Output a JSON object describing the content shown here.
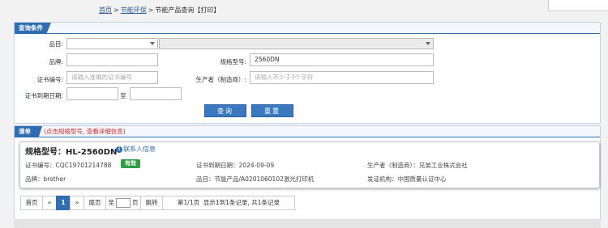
{
  "breadcrumb": {
    "home": "首页",
    "category": "节能环保",
    "current": "节能产品查询",
    "print": "【打印】"
  },
  "query": {
    "title": "查询条件",
    "category_label": "品目:",
    "brand_label": "品牌:",
    "model_label": "规格型号:",
    "model_value": "2560DN",
    "cert_label": "证书编号:",
    "cert_placeholder": "请输入准确的证书编号",
    "maker_label": "生产者（制造商）:",
    "maker_placeholder": "请输入不少于3个字符",
    "expiry_label": "证书到期日期:",
    "to_label": "至",
    "search_button": "查询",
    "reset_button": "重置"
  },
  "list": {
    "title": "清单",
    "note": "(点击规格型号, 查看详细信息)",
    "item": {
      "model_title": "规格型号：HL-2560DN",
      "contact": "联系人信息",
      "cert": "证书编号：CQC19701214788",
      "status": "有效",
      "expiry": "证书到期日期：2024-09-09",
      "maker": "生产者（制造商）：兄弟工业株式会社",
      "brand": "品牌：brother",
      "category": "品目：节能产品/A0201060102激光打印机",
      "agency": "发证机构：中国质量认证中心"
    }
  },
  "pager": {
    "first": "首页",
    "prev": "«",
    "page": "1",
    "next": "»",
    "last": "尾页",
    "goto_prefix": "至",
    "goto_suffix": "页",
    "jump": "跳转",
    "summary": "第1/1页  显示1到1条记录, 共1条记录"
  },
  "colors": {
    "accent": "#2f6db3",
    "status": "#2e9e45",
    "note": "#d9262c"
  }
}
